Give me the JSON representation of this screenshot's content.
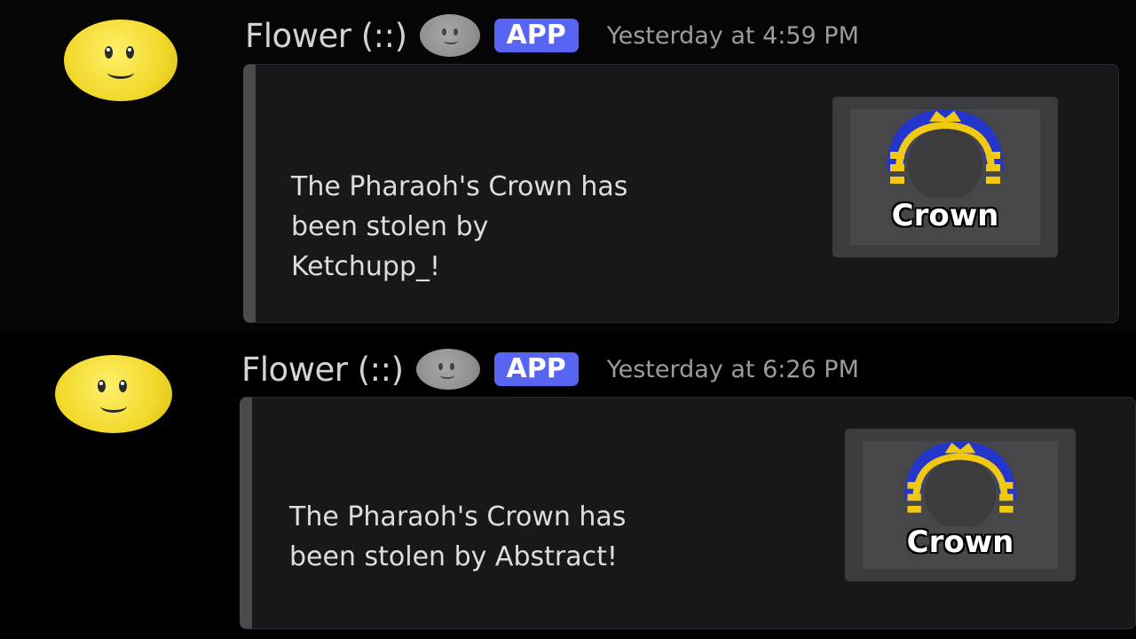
{
  "messages": [
    {
      "username": "Flower (::)",
      "badge": "APP",
      "timestamp": "Yesterday at 4:59 PM",
      "embed": {
        "lines": [
          "The Pharaoh's Crown has",
          "been stolen by",
          "Ketchupp_!"
        ],
        "thumbnail_label": "Crown",
        "thumbnail_icon": "pharaoh-crown-icon"
      }
    },
    {
      "username": "Flower (::)",
      "badge": "APP",
      "timestamp": "Yesterday at 6:26 PM",
      "embed": {
        "lines": [
          "The Pharaoh's Crown has",
          "been stolen by Abstract!"
        ],
        "thumbnail_label": "Crown",
        "thumbnail_icon": "pharaoh-crown-icon"
      }
    }
  ],
  "colors": {
    "background": "#000000",
    "embed_bg": "#17181b",
    "app_badge": "#5865f2",
    "crown_gold": "#f2c912",
    "crown_blue": "#2436c9"
  }
}
